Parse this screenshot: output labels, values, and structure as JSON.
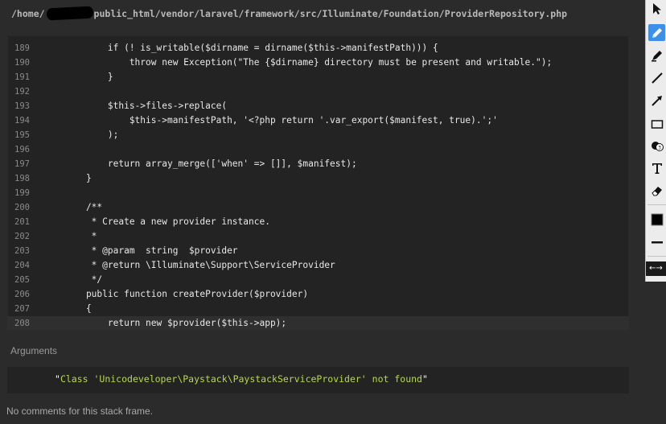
{
  "file_path": {
    "prefix": "/home/",
    "suffix": "public_html/vendor/laravel/framework/src/Illuminate/Foundation/ProviderRepository.php"
  },
  "code_lines": [
    {
      "n": "189",
      "code": "        if (! is_writable($dirname = dirname($this->manifestPath))) {"
    },
    {
      "n": "190",
      "code": "            throw new Exception(\"The {$dirname} directory must be present and writable.\");"
    },
    {
      "n": "191",
      "code": "        }"
    },
    {
      "n": "192",
      "code": ""
    },
    {
      "n": "193",
      "code": "        $this->files->replace("
    },
    {
      "n": "194",
      "code": "            $this->manifestPath, '<?php return '.var_export($manifest, true).';'"
    },
    {
      "n": "195",
      "code": "        );"
    },
    {
      "n": "196",
      "code": ""
    },
    {
      "n": "197",
      "code": "        return array_merge(['when' => []], $manifest);"
    },
    {
      "n": "198",
      "code": "    }"
    },
    {
      "n": "199",
      "code": ""
    },
    {
      "n": "200",
      "code": "    /**"
    },
    {
      "n": "201",
      "code": "     * Create a new provider instance."
    },
    {
      "n": "202",
      "code": "     *"
    },
    {
      "n": "203",
      "code": "     * @param  string  $provider"
    },
    {
      "n": "204",
      "code": "     * @return \\Illuminate\\Support\\ServiceProvider"
    },
    {
      "n": "205",
      "code": "     */"
    },
    {
      "n": "206",
      "code": "    public function createProvider($provider)"
    },
    {
      "n": "207",
      "code": "    {"
    },
    {
      "n": "208",
      "code": "        return new $provider($this->app);"
    }
  ],
  "current_line": "208",
  "arguments": {
    "title": "Arguments",
    "quote": "\"",
    "value": "Class 'Unicodeveloper\\Paystack\\PaystackServiceProvider' not found"
  },
  "comments": {
    "empty_text": "No comments for this stack frame."
  },
  "toolbar": {
    "tools": [
      {
        "icon": "select-arrow-icon",
        "active": false
      },
      {
        "icon": "pen-icon",
        "active": true
      },
      {
        "icon": "marker-icon",
        "active": false
      },
      {
        "icon": "line-icon",
        "active": false
      },
      {
        "icon": "arrow-icon",
        "active": false
      },
      {
        "icon": "rectangle-icon",
        "active": false
      },
      {
        "icon": "step-number-icon",
        "active": false
      },
      {
        "icon": "text-icon",
        "active": false
      },
      {
        "icon": "eraser-icon",
        "active": false
      },
      {
        "icon": "color-swatch-icon",
        "active": false
      },
      {
        "icon": "line-width-icon",
        "active": false
      }
    ]
  },
  "colors": {
    "background": "#2b2b2b",
    "panel": "#232323",
    "argument_string": "#b8d94a",
    "toolbar_active": "#3d8fe8"
  }
}
